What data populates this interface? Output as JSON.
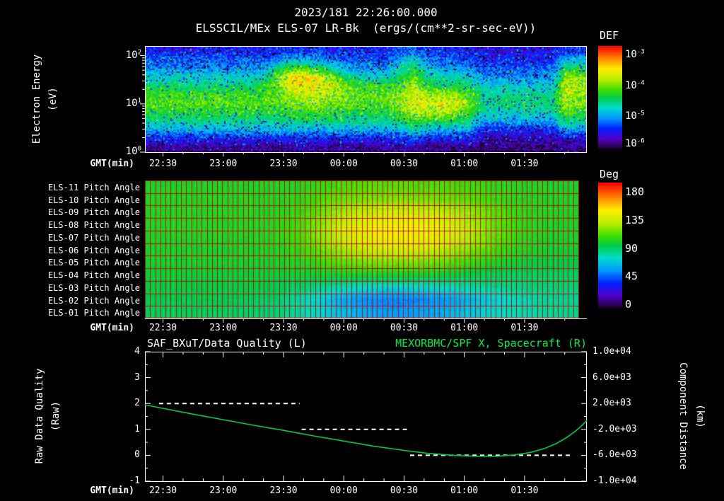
{
  "colors": {
    "text": "#ffffff",
    "grid_red": "#bb0000",
    "series_green": "#00cc44",
    "title_green": "#00ee44",
    "axis": "#ffffff"
  },
  "colormap": {
    "stops": [
      [
        0.0,
        "#1a0030"
      ],
      [
        0.1,
        "#5500cc"
      ],
      [
        0.2,
        "#0022ff"
      ],
      [
        0.3,
        "#0099ff"
      ],
      [
        0.4,
        "#00ddcc"
      ],
      [
        0.5,
        "#00cc44"
      ],
      [
        0.58,
        "#44dd00"
      ],
      [
        0.68,
        "#bbee00"
      ],
      [
        0.78,
        "#ffee00"
      ],
      [
        0.88,
        "#ff8800"
      ],
      [
        1.0,
        "#ff0000"
      ]
    ]
  },
  "time_axis": {
    "label": "GMT(min)",
    "range_min": [
      21,
      241
    ],
    "major_ticks": [
      {
        "min": 30,
        "label": "22:30"
      },
      {
        "min": 60,
        "label": "23:00"
      },
      {
        "min": 90,
        "label": "23:30"
      },
      {
        "min": 120,
        "label": "00:00"
      },
      {
        "min": 150,
        "label": "00:30"
      },
      {
        "min": 180,
        "label": "01:00"
      },
      {
        "min": 210,
        "label": "01:30"
      }
    ],
    "minor_step_min": 10
  },
  "chart_data": [
    {
      "type": "heatmap",
      "name": "electron-energy-spectrogram",
      "subtitle": "2023/181 22:26:00.000",
      "title": "ELSSCIL/MEx ELS-07 LR-Bk  (ergs/(cm**2-sr-sec-eV))",
      "xlabel": "GMT(min)",
      "ylabel_line1": "Electron Energy",
      "ylabel_line2": "(eV)",
      "y_ticks": [
        {
          "log": 2,
          "label": "10^2"
        },
        {
          "log": 1,
          "label": "10^1"
        },
        {
          "log": 0,
          "label": "10^0"
        }
      ],
      "y_log_range": [
        0,
        2.2
      ],
      "colorbar": {
        "title": "DEF",
        "ticks": [
          {
            "frac": 0.09,
            "label": "10^-3"
          },
          {
            "frac": 0.39,
            "label": "10^-4"
          },
          {
            "frac": 0.69,
            "label": "10^-5"
          },
          {
            "frac": 0.96,
            "label": "10^-6"
          }
        ]
      },
      "value_scale": "log10(DEF)",
      "value_range": [
        -6.6,
        -3.2
      ],
      "grid": [
        [
          -6.0,
          -6.0,
          -6.0,
          -6.0,
          -6.0,
          -6.0,
          -6.0,
          -6.0,
          -6.0,
          -6.0,
          -5.9,
          -5.9,
          -5.9,
          -6.0,
          -6.0,
          -6.0,
          -6.0,
          -6.0,
          -5.8,
          -5.7,
          -5.9,
          -6.0,
          -6.0,
          -6.0,
          -6.1,
          -6.1,
          -6.1,
          -6.1,
          -6.1,
          -6.1,
          -5.9,
          -5.9
        ],
        [
          -5.8,
          -5.8,
          -5.8,
          -5.8,
          -5.8,
          -5.8,
          -5.8,
          -5.8,
          -5.8,
          -5.7,
          -5.5,
          -5.5,
          -5.6,
          -5.7,
          -5.8,
          -5.8,
          -5.8,
          -5.8,
          -5.5,
          -5.3,
          -5.7,
          -5.8,
          -5.8,
          -5.8,
          -6.0,
          -6.0,
          -6.0,
          -6.0,
          -6.0,
          -6.0,
          -5.5,
          -5.5
        ],
        [
          -5.6,
          -5.6,
          -5.6,
          -5.6,
          -5.6,
          -5.6,
          -5.6,
          -5.6,
          -5.6,
          -5.1,
          -4.7,
          -4.7,
          -4.9,
          -5.2,
          -5.5,
          -5.6,
          -5.6,
          -5.6,
          -5.2,
          -4.9,
          -5.4,
          -5.6,
          -5.6,
          -5.6,
          -5.8,
          -5.8,
          -5.8,
          -5.8,
          -5.8,
          -5.8,
          -4.9,
          -5.0
        ],
        [
          -5.3,
          -5.3,
          -5.3,
          -5.3,
          -5.3,
          -5.3,
          -5.3,
          -5.3,
          -5.2,
          -4.5,
          -3.9,
          -3.9,
          -4.0,
          -4.4,
          -5.0,
          -5.2,
          -5.2,
          -5.2,
          -4.9,
          -4.6,
          -5.1,
          -5.2,
          -5.2,
          -5.3,
          -5.6,
          -5.6,
          -5.6,
          -5.6,
          -5.6,
          -5.6,
          -4.4,
          -4.5
        ],
        [
          -5.0,
          -5.0,
          -5.0,
          -5.0,
          -5.0,
          -5.0,
          -5.0,
          -5.0,
          -4.9,
          -4.6,
          -4.1,
          -4.0,
          -4.0,
          -4.2,
          -4.5,
          -4.7,
          -4.7,
          -4.7,
          -4.6,
          -4.3,
          -4.8,
          -4.9,
          -4.9,
          -5.0,
          -5.3,
          -5.3,
          -5.3,
          -5.3,
          -5.3,
          -5.3,
          -4.2,
          -4.4
        ],
        [
          -4.7,
          -4.7,
          -4.7,
          -4.7,
          -4.7,
          -4.7,
          -4.7,
          -4.7,
          -4.7,
          -4.6,
          -4.4,
          -4.2,
          -4.2,
          -4.3,
          -4.5,
          -4.6,
          -4.6,
          -4.6,
          -4.5,
          -4.2,
          -4.3,
          -4.3,
          -4.4,
          -4.6,
          -5.1,
          -5.1,
          -5.1,
          -5.1,
          -5.1,
          -5.1,
          -4.2,
          -4.4
        ],
        [
          -4.6,
          -4.6,
          -4.6,
          -4.6,
          -4.6,
          -4.6,
          -4.6,
          -4.6,
          -4.6,
          -4.6,
          -4.5,
          -4.4,
          -4.4,
          -4.5,
          -4.5,
          -4.6,
          -4.6,
          -4.6,
          -4.4,
          -4.1,
          -4.1,
          -4.1,
          -4.2,
          -4.5,
          -5.0,
          -5.0,
          -5.0,
          -5.0,
          -5.0,
          -5.0,
          -4.3,
          -4.5
        ],
        [
          -4.8,
          -4.8,
          -4.8,
          -4.8,
          -4.8,
          -4.8,
          -4.8,
          -4.8,
          -4.8,
          -4.8,
          -4.7,
          -4.7,
          -4.7,
          -4.7,
          -4.8,
          -4.8,
          -4.8,
          -4.8,
          -4.6,
          -4.3,
          -4.3,
          -4.3,
          -4.4,
          -4.7,
          -5.2,
          -5.2,
          -5.2,
          -5.2,
          -5.2,
          -5.2,
          -4.5,
          -4.7
        ],
        [
          -5.1,
          -5.1,
          -5.1,
          -5.1,
          -5.1,
          -5.1,
          -5.1,
          -5.1,
          -5.1,
          -5.1,
          -5.0,
          -5.0,
          -5.0,
          -5.0,
          -5.1,
          -5.1,
          -5.1,
          -5.1,
          -4.9,
          -4.7,
          -4.8,
          -4.8,
          -4.9,
          -5.0,
          -5.5,
          -5.5,
          -5.5,
          -5.5,
          -5.5,
          -5.5,
          -5.0,
          -5.1
        ],
        [
          -5.5,
          -5.5,
          -5.5,
          -5.5,
          -5.5,
          -5.5,
          -5.5,
          -5.5,
          -5.5,
          -5.5,
          -5.5,
          -5.5,
          -5.5,
          -5.5,
          -5.5,
          -5.5,
          -5.5,
          -5.5,
          -5.4,
          -5.2,
          -5.4,
          -5.5,
          -5.5,
          -5.5,
          -6.0,
          -6.0,
          -6.0,
          -6.0,
          -6.0,
          -6.0,
          -5.5,
          -5.6
        ],
        [
          -6.0,
          -6.0,
          -6.0,
          -6.0,
          -6.0,
          -6.0,
          -6.0,
          -6.0,
          -6.0,
          -6.0,
          -6.0,
          -6.0,
          -6.0,
          -6.0,
          -6.0,
          -6.0,
          -6.0,
          -6.0,
          -5.9,
          -5.8,
          -6.0,
          -6.0,
          -6.0,
          -6.0,
          -6.3,
          -6.3,
          -6.3,
          -6.3,
          -6.3,
          -6.3,
          -6.1,
          -6.1
        ],
        [
          -6.4,
          -6.4,
          -6.4,
          -6.4,
          -6.4,
          -6.4,
          -6.4,
          -6.4,
          -6.4,
          -6.4,
          -6.3,
          -6.3,
          -6.3,
          -6.4,
          -6.4,
          -6.4,
          -6.4,
          -6.4,
          -6.3,
          -6.3,
          -6.4,
          -6.4,
          -6.4,
          -6.4,
          -6.5,
          -6.5,
          -6.5,
          -6.5,
          -6.5,
          -6.5,
          -6.4,
          -6.4
        ]
      ]
    },
    {
      "type": "heatmap",
      "name": "pitch-angle-panel",
      "xlabel": "GMT(min)",
      "row_labels": [
        "ELS-11 Pitch Angle",
        "ELS-10 Pitch Angle",
        "ELS-09 Pitch Angle",
        "ELS-08 Pitch Angle",
        "ELS-07 Pitch Angle",
        "ELS-06 Pitch Angle",
        "ELS-05 Pitch Angle",
        "ELS-04 Pitch Angle",
        "ELS-03 Pitch Angle",
        "ELS-02 Pitch Angle",
        "ELS-01 Pitch Angle"
      ],
      "colorbar": {
        "title": "Deg",
        "ticks": [
          {
            "frac": 0.05,
            "label": "180"
          },
          {
            "frac": 0.275,
            "label": "135"
          },
          {
            "frac": 0.5,
            "label": "90"
          },
          {
            "frac": 0.725,
            "label": "45"
          },
          {
            "frac": 0.95,
            "label": "0"
          }
        ]
      },
      "value_scale": "degrees",
      "value_range": [
        0,
        180
      ],
      "grid": [
        [
          96,
          96,
          96,
          96,
          96,
          96,
          96,
          96,
          97,
          100,
          103,
          105,
          106,
          106,
          106,
          105,
          104,
          103,
          101,
          99,
          97,
          96,
          95,
          95
        ],
        [
          97,
          97,
          97,
          97,
          97,
          97,
          97,
          97,
          99,
          103,
          107,
          110,
          111,
          112,
          112,
          111,
          109,
          107,
          104,
          101,
          98,
          97,
          96,
          96
        ],
        [
          97,
          97,
          97,
          97,
          97,
          97,
          97,
          98,
          101,
          107,
          115,
          121,
          124,
          126,
          126,
          125,
          122,
          118,
          112,
          106,
          101,
          98,
          96,
          96
        ],
        [
          97,
          97,
          97,
          97,
          97,
          97,
          97,
          99,
          104,
          112,
          122,
          129,
          133,
          135,
          135,
          134,
          130,
          124,
          116,
          108,
          102,
          98,
          96,
          96
        ],
        [
          96,
          96,
          96,
          96,
          96,
          96,
          97,
          99,
          104,
          112,
          122,
          129,
          133,
          135,
          135,
          134,
          130,
          124,
          116,
          108,
          101,
          97,
          95,
          95
        ],
        [
          95,
          95,
          95,
          95,
          95,
          95,
          96,
          97,
          101,
          107,
          115,
          121,
          125,
          126,
          126,
          125,
          121,
          116,
          109,
          103,
          98,
          95,
          93,
          93
        ],
        [
          94,
          94,
          94,
          94,
          94,
          94,
          94,
          95,
          97,
          101,
          106,
          110,
          112,
          113,
          113,
          112,
          109,
          105,
          100,
          96,
          93,
          91,
          90,
          90
        ],
        [
          92,
          92,
          92,
          92,
          92,
          92,
          92,
          92,
          92,
          93,
          94,
          95,
          95,
          95,
          95,
          94,
          92,
          90,
          88,
          87,
          86,
          86,
          86,
          86
        ],
        [
          90,
          90,
          90,
          90,
          90,
          90,
          89,
          88,
          85,
          81,
          77,
          74,
          72,
          71,
          71,
          72,
          74,
          76,
          78,
          80,
          81,
          82,
          83,
          83
        ],
        [
          88,
          88,
          88,
          88,
          88,
          87,
          86,
          83,
          77,
          70,
          62,
          56,
          53,
          51,
          51,
          52,
          55,
          59,
          64,
          69,
          73,
          76,
          78,
          79
        ],
        [
          86,
          86,
          86,
          86,
          86,
          85,
          84,
          82,
          78,
          72,
          66,
          61,
          58,
          56,
          56,
          58,
          60,
          64,
          68,
          72,
          75,
          77,
          79,
          80
        ]
      ]
    },
    {
      "type": "line",
      "name": "quality-and-spacecraft-distance",
      "title_left": "SAF_BXuT/Data Quality (L)",
      "title_right": "MEXORBMC/SPF X, Spacecraft (R)",
      "xlabel": "GMT(min)",
      "left_axis": {
        "label_line1": "Raw Data Quality",
        "label_line2": "(Raw)",
        "range": [
          -1,
          4
        ],
        "ticks": [
          {
            "v": 4,
            "label": "4"
          },
          {
            "v": 3,
            "label": "3"
          },
          {
            "v": 2,
            "label": "2"
          },
          {
            "v": 1,
            "label": "1"
          },
          {
            "v": 0,
            "label": "0"
          },
          {
            "v": -1,
            "label": "-1"
          }
        ]
      },
      "right_axis": {
        "label_line1": "Component Distance",
        "label_line2": "(km)",
        "range": [
          -10000,
          10000
        ],
        "ticks": [
          {
            "v": 10000,
            "label": "1.0e+04"
          },
          {
            "v": 6000,
            "label": "6.0e+03"
          },
          {
            "v": 2000,
            "label": "2.0e+03"
          },
          {
            "v": -2000,
            "label": "-2.0e+03"
          },
          {
            "v": -6000,
            "label": "-6.0e+03"
          },
          {
            "v": -10000,
            "label": "-1.0e+04"
          }
        ]
      },
      "series": [
        {
          "name": "SAF_BXuT/Data Quality",
          "axis": "left",
          "style": "dashed",
          "color": "#ffffff",
          "segments": [
            {
              "value": 2,
              "t_start_min": 28,
              "t_end_min": 98
            },
            {
              "value": 1,
              "t_start_min": 99,
              "t_end_min": 152
            },
            {
              "value": 0,
              "t_start_min": 153,
              "t_end_min": 234
            }
          ]
        },
        {
          "name": "MEXORBMC/SPF X Spacecraft",
          "axis": "right",
          "style": "solid",
          "color": "#00cc44",
          "points": [
            [
              21,
              1800
            ],
            [
              30,
              1250
            ],
            [
              45,
              350
            ],
            [
              60,
              -500
            ],
            [
              75,
              -1350
            ],
            [
              90,
              -2150
            ],
            [
              105,
              -3000
            ],
            [
              120,
              -3800
            ],
            [
              135,
              -4600
            ],
            [
              150,
              -5250
            ],
            [
              162,
              -5700
            ],
            [
              174,
              -6000
            ],
            [
              186,
              -6150
            ],
            [
              196,
              -6150
            ],
            [
              205,
              -5950
            ],
            [
              213,
              -5550
            ],
            [
              220,
              -4950
            ],
            [
              226,
              -4150
            ],
            [
              231,
              -3250
            ],
            [
              235,
              -2350
            ],
            [
              238,
              -1550
            ],
            [
              240,
              -950
            ],
            [
              241,
              -600
            ]
          ]
        }
      ]
    }
  ]
}
